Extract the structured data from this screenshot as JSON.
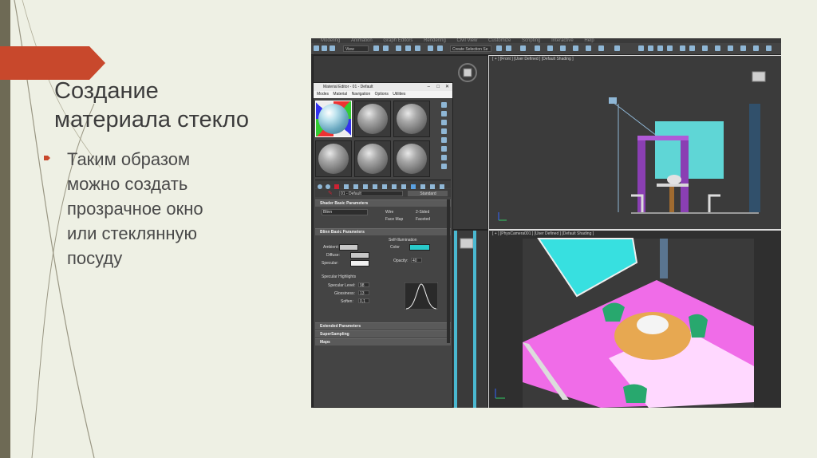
{
  "slide": {
    "title": "Создание\nматериала стекло",
    "bullet_text": "Таким образом\nможно создать\nпрозрачное окно\nили стеклянную\nпосуду"
  },
  "colors": {
    "ribbon": "#c8482c",
    "accent_bar": "#6e6a55",
    "background": "#eef0e4",
    "self_illum_color": "#29c9c9"
  },
  "app": {
    "menu": [
      "Modeling",
      "Animation",
      "Graph Editors",
      "Rendering",
      "Civil View",
      "Customize",
      "Scripting",
      "Interactive",
      "Help"
    ],
    "toolbar": {
      "view_dropdown": "View",
      "selection_set_dropdown": "Create Selection Se"
    },
    "viewports": {
      "front_label": "[ + ] [Front ] [User Defined ] [Default Shading ]",
      "camera_label": "[ + ] [PhysCamera001 ] [User Defined ] [Default Shading ]"
    },
    "material_editor": {
      "title": "Material Editor - 01 - Default",
      "menu": [
        "Modes",
        "Material",
        "Navigation",
        "Options",
        "Utilities"
      ],
      "material_name": "01 - Default",
      "type_button": "Standard",
      "shader_rollout": "Shader Basic Parameters",
      "shader_type": "Blinn",
      "shader_options": [
        "Wire",
        "2-Sided",
        "Face Map",
        "Faceted"
      ],
      "blinn_rollout": "Blinn Basic Parameters",
      "self_illumination_label": "Self-Illumination",
      "self_illum_color_label": "Color",
      "ambient_label": "Ambient:",
      "diffuse_label": "Diffuse:",
      "specular_label": "Specular:",
      "opacity_label": "Opacity:",
      "opacity_value": "40",
      "specular_highlights_label": "Specular Highlights",
      "specular_level_label": "Specular Level:",
      "specular_level_value": "98",
      "glossiness_label": "Glossiness:",
      "glossiness_value": "13",
      "soften_label": "Soften:",
      "soften_value": "0,1",
      "rollouts_collapsed": [
        "Extended Parameters",
        "SuperSampling",
        "Maps"
      ]
    }
  }
}
